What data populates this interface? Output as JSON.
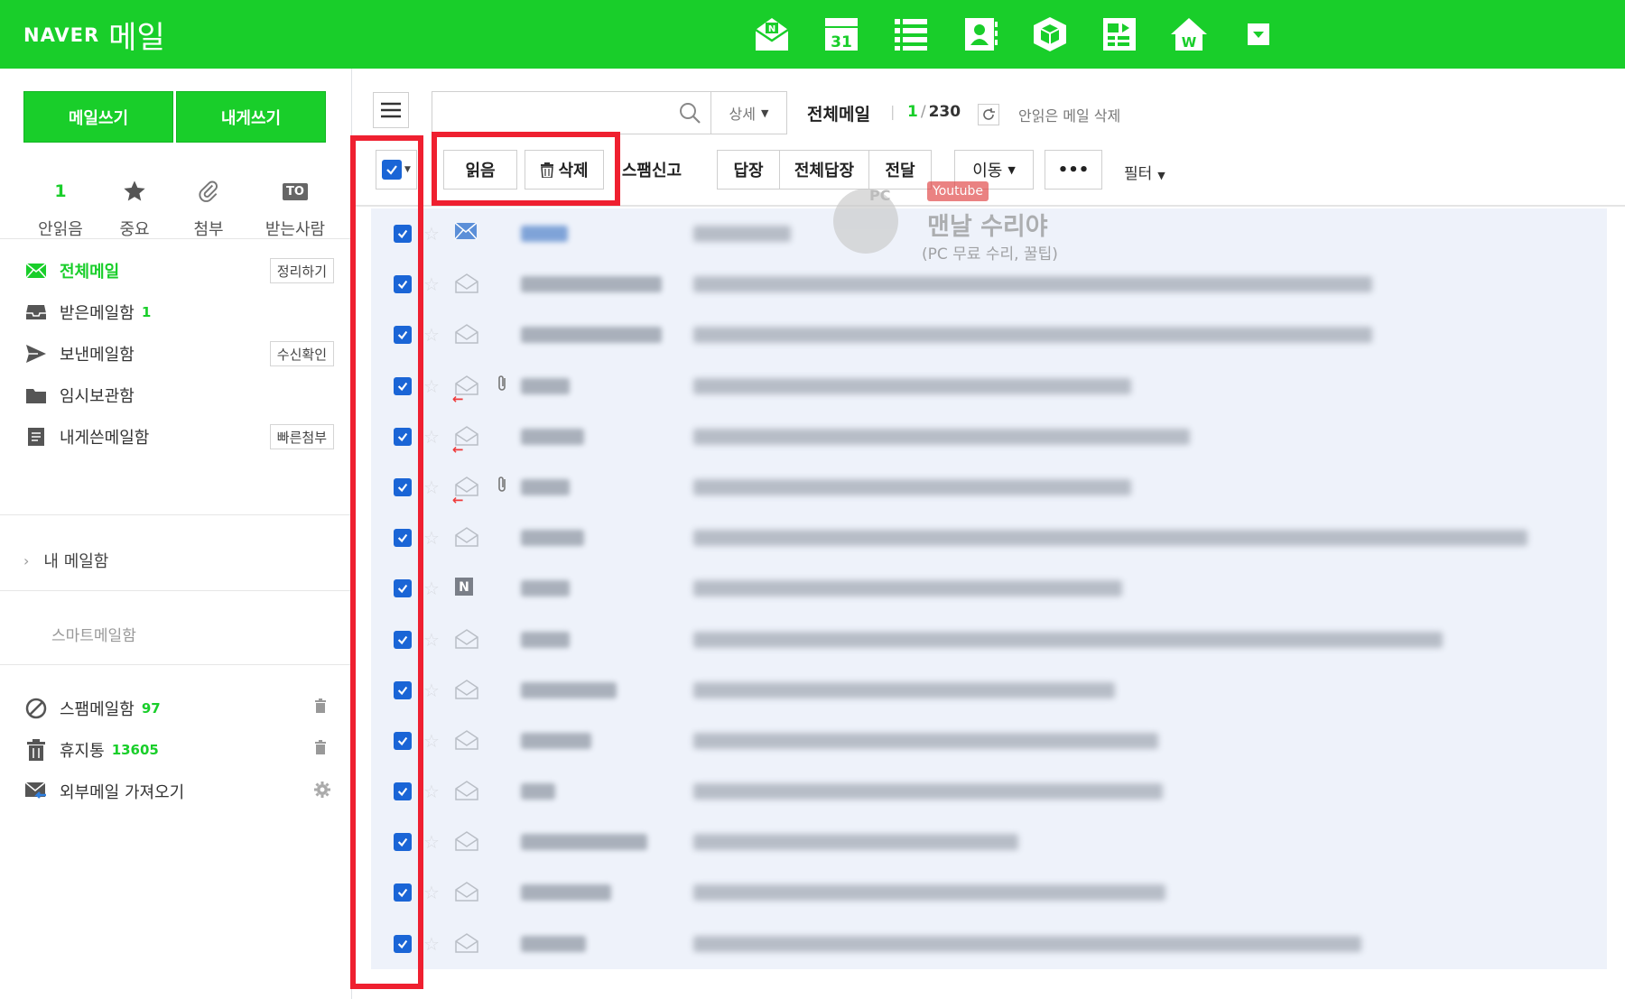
{
  "header": {
    "brand_naver": "NAVER",
    "brand_mail": "메일",
    "color": "#19ce2a",
    "apps": [
      "mail-app-icon",
      "calendar-icon",
      "list-icon",
      "contacts-icon",
      "box-icon",
      "memo-icon",
      "home-icon",
      "more-apps-icon"
    ],
    "calendar_day": "31"
  },
  "sidebar": {
    "write_mail": "메일쓰기",
    "write_self": "내게쓰기",
    "quick": {
      "unread_count": "1",
      "unread_label": "안읽음",
      "important_label": "중요",
      "attach_label": "첨부",
      "to_badge": "TO",
      "to_label": "받는사람"
    },
    "folders": [
      {
        "label": "전체메일",
        "action": "정리하기",
        "icon": "all-mail-icon"
      },
      {
        "label": "받은메일함",
        "count": "1",
        "icon": "inbox-icon"
      },
      {
        "label": "보낸메일함",
        "action": "수신확인",
        "icon": "sent-icon"
      },
      {
        "label": "임시보관함",
        "icon": "drafts-folder-icon"
      },
      {
        "label": "내게쓴메일함",
        "action": "빠른첨부",
        "icon": "self-mail-icon"
      }
    ],
    "my_mailbox": "내 메일함",
    "smart_mailbox": "스마트메일함",
    "spam": {
      "label": "스팸메일함",
      "count": "97"
    },
    "trash": {
      "label": "휴지통",
      "count": "13605"
    },
    "external": {
      "label": "외부메일 가져오기"
    }
  },
  "main": {
    "search_placeholder": "",
    "detail": "상세",
    "mailbox_title": "전체메일",
    "unread": "1",
    "total": "230",
    "delete_unread": "안읽은 메일 삭제",
    "toolbar": {
      "read": "읽음",
      "delete": "삭제",
      "spam": "스팸신고",
      "reply": "답장",
      "reply_all": "전체답장",
      "forward": "전달",
      "move": "이동",
      "more": "•••",
      "filter": "필터"
    },
    "rows": [
      {
        "icon": "n",
        "env": "blue",
        "attach": false,
        "replied": false
      },
      {
        "env": "open",
        "attach": false,
        "replied": false
      },
      {
        "env": "open",
        "attach": false,
        "replied": false
      },
      {
        "env": "open",
        "attach": true,
        "replied": true
      },
      {
        "env": "open",
        "attach": false,
        "replied": true
      },
      {
        "env": "open",
        "attach": true,
        "replied": true
      },
      {
        "env": "open",
        "attach": false,
        "replied": false
      },
      {
        "env": "naver",
        "attach": false,
        "replied": false
      },
      {
        "env": "open",
        "attach": false,
        "replied": false
      },
      {
        "env": "open",
        "attach": false,
        "replied": false
      },
      {
        "env": "open",
        "attach": false,
        "replied": false
      },
      {
        "env": "open",
        "attach": false,
        "replied": false
      },
      {
        "env": "open",
        "attach": false,
        "replied": false
      },
      {
        "env": "open",
        "attach": false,
        "replied": false
      },
      {
        "env": "open",
        "attach": false,
        "replied": false
      }
    ]
  },
  "watermark": {
    "pc": "PC",
    "youtube": "Youtube",
    "title": "맨날 수리야",
    "subtitle": "(PC 무료 수리, 꿀팁)"
  },
  "accent_colors": {
    "green": "#19ce2a",
    "highlight": "#ef2030",
    "checkbox": "#1a65d6"
  }
}
